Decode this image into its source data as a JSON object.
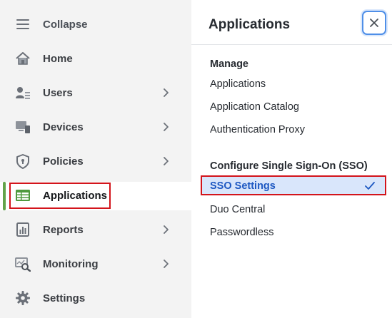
{
  "nav": {
    "collapse_label": "Collapse",
    "items": [
      {
        "label": "Home",
        "icon": "home-icon",
        "has_submenu": false
      },
      {
        "label": "Users",
        "icon": "users-icon",
        "has_submenu": true
      },
      {
        "label": "Devices",
        "icon": "devices-icon",
        "has_submenu": true
      },
      {
        "label": "Policies",
        "icon": "policies-icon",
        "has_submenu": true
      },
      {
        "label": "Applications",
        "icon": "applications-icon",
        "has_submenu": false,
        "active": true
      },
      {
        "label": "Reports",
        "icon": "reports-icon",
        "has_submenu": true
      },
      {
        "label": "Monitoring",
        "icon": "monitoring-icon",
        "has_submenu": true
      },
      {
        "label": "Settings",
        "icon": "settings-icon",
        "has_submenu": false
      }
    ]
  },
  "panel": {
    "title": "Applications",
    "close_icon": "close-icon",
    "sections": [
      {
        "title": "Manage",
        "links": [
          "Applications",
          "Application Catalog",
          "Authentication Proxy"
        ]
      },
      {
        "title": "Configure Single Sign-On (SSO)",
        "links": [
          "SSO Settings",
          "Duo Central",
          "Passwordless"
        ]
      }
    ],
    "selected_link": "SSO Settings"
  },
  "colors": {
    "accent_blue": "#1d58c2",
    "selected_bg": "#d9e6fb",
    "active_bar": "#63a34a",
    "highlight_red": "#d3141b",
    "nav_bg": "#f3f3f3"
  }
}
